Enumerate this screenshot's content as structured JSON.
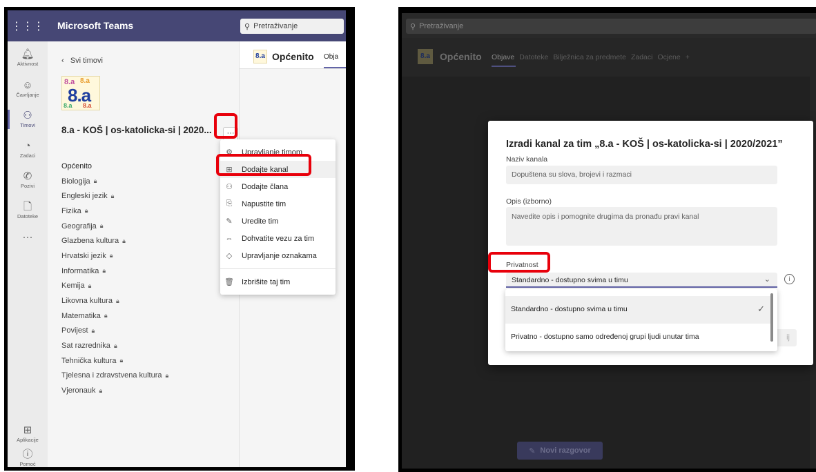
{
  "left": {
    "app_title": "Microsoft Teams",
    "search_placeholder": "Pretraživanje",
    "rail": [
      {
        "icon": "bell-icon",
        "label": "Aktivnost"
      },
      {
        "icon": "chat-icon",
        "label": "Čavrljanje"
      },
      {
        "icon": "teams-icon",
        "label": "Timovi",
        "active": true
      },
      {
        "icon": "assignments-icon",
        "label": "Zadaci"
      },
      {
        "icon": "phone-icon",
        "label": "Pozivi"
      },
      {
        "icon": "file-icon",
        "label": "Datoteke"
      },
      {
        "icon": "more-icon",
        "label": ""
      },
      {
        "icon": "apps-icon",
        "label": "Aplikacije"
      },
      {
        "icon": "help-icon",
        "label": "Pomoć"
      }
    ],
    "back_link": "Svi timovi",
    "team_name": "8.a - KOŠ | os-katolicka-si | 2020...",
    "team_logo_text": "8.a",
    "channels": [
      {
        "name": "Općenito",
        "locked": false
      },
      {
        "name": "Biologija",
        "locked": true
      },
      {
        "name": "Engleski jezik",
        "locked": true
      },
      {
        "name": "Fizika",
        "locked": true
      },
      {
        "name": "Geografija",
        "locked": true
      },
      {
        "name": "Glazbena kultura",
        "locked": true
      },
      {
        "name": "Hrvatski jezik",
        "locked": true
      },
      {
        "name": "Informatika",
        "locked": true
      },
      {
        "name": "Kemija",
        "locked": true
      },
      {
        "name": "Likovna kultura",
        "locked": true
      },
      {
        "name": "Matematika",
        "locked": true
      },
      {
        "name": "Povijest",
        "locked": true
      },
      {
        "name": "Sat razrednika",
        "locked": true
      },
      {
        "name": "Tehnička kultura",
        "locked": true
      },
      {
        "name": "Tjelesna i zdravstvena kultura",
        "locked": true
      },
      {
        "name": "Vjeronauk",
        "locked": true
      }
    ],
    "channel_header": {
      "title": "Općenito",
      "tab": "Obja"
    },
    "more_button_label": "···",
    "menu": [
      {
        "icon": "gear-icon",
        "label": "Upravljanje timom"
      },
      {
        "icon": "add-channel-icon",
        "label": "Dodajte kanal",
        "hover": true
      },
      {
        "icon": "add-member-icon",
        "label": "Dodajte člana"
      },
      {
        "icon": "leave-team-icon",
        "label": "Napustite tim"
      },
      {
        "icon": "pencil-icon",
        "label": "Uredite tim"
      },
      {
        "icon": "link-icon",
        "label": "Dohvatite vezu za tim"
      },
      {
        "icon": "tag-icon",
        "label": "Upravljanje oznakama"
      },
      {
        "icon": "trash-icon",
        "label": "Izbrišite taj tim",
        "separator_before": true
      }
    ]
  },
  "right": {
    "search_placeholder": "Pretraživanje",
    "channel_title": "Općenito",
    "logo_text": "8.a",
    "tabs": [
      "Objave",
      "Datoteke",
      "Bilježnica za predmete",
      "Zadaci",
      "Ocjene",
      "+"
    ],
    "new_conversation": "Novi razgovor",
    "dialog": {
      "title": "Izradi kanal za tim „8.a - KOŠ | os-katolicka-si | 2020/2021”",
      "name_label": "Naziv kanala",
      "name_placeholder": "Dopuštena su slova, brojevi i razmaci",
      "desc_label": "Opis (izborno)",
      "desc_placeholder": "Navedite opis i pomognite drugima da pronađu pravi kanal",
      "privacy_label": "Privatnost",
      "privacy_selected": "Standardno - dostupno svima u timu",
      "options": [
        "Standardno - dostupno svima u timu",
        "Privatno - dostupno samo određenoj grupi ljudi unutar tima"
      ],
      "partial_button": "ij"
    }
  },
  "colors": {
    "teams_purple": "#464775",
    "accent": "#6264a7",
    "highlight_red": "#e8000b"
  }
}
